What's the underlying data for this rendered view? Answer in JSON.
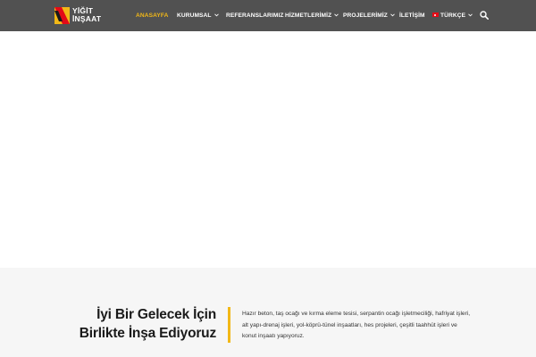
{
  "colors": {
    "header_bg": "#515151",
    "accent": "#f2b817",
    "section_bg": "#f6f6f6"
  },
  "logo": {
    "line1": "YİĞİT",
    "line2": "İNŞAAT",
    "icon": "yigit-logo-icon"
  },
  "nav": {
    "items": [
      {
        "label": "ANASAYFA",
        "active": true,
        "dropdown": false
      },
      {
        "label": "KURUMSAL",
        "active": false,
        "dropdown": true
      },
      {
        "label": "REFERANSLARIMIZ",
        "active": false,
        "dropdown": false
      },
      {
        "label": "HİZMETLERİMİZ",
        "active": false,
        "dropdown": true
      },
      {
        "label": "PROJELERİMİZ",
        "active": false,
        "dropdown": true
      },
      {
        "label": "İLETİŞİM",
        "active": false,
        "dropdown": false
      },
      {
        "label": "TÜRKÇE",
        "active": false,
        "dropdown": true,
        "icon": "turkish-flag-icon"
      }
    ],
    "search_icon": "search-icon"
  },
  "about": {
    "title_line1": "İyi Bir Gelecek İçin",
    "title_line2": "Birlikte İnşa Ediyoruz",
    "line1": "Hazır beton, taş ocağı ve kırma eleme tesisi, serpantin ocağı işletmeciliği, hafriyat işleri,",
    "line2": "alt yapı-drenaj işleri, yol-köprü-tünel inşaatları, hes projeleri, çeşitli taahhüt işleri ve",
    "line3": "konut inşaatı yapıyoruz."
  }
}
